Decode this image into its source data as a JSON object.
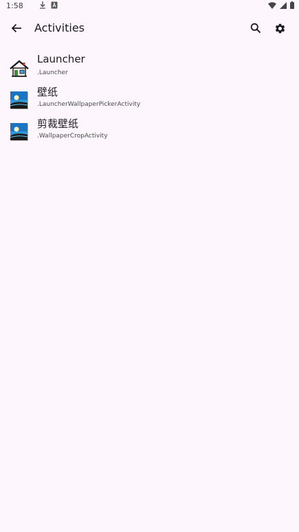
{
  "status_bar": {
    "time": "1:58",
    "icons": [
      "download-icon",
      "notification-a-icon",
      "wifi-icon",
      "cell-signal-icon",
      "battery-icon"
    ]
  },
  "app_bar": {
    "title": "Activities",
    "back_icon": "arrow-back-icon",
    "search_icon": "search-icon",
    "settings_icon": "gear-icon"
  },
  "activities": [
    {
      "name": "Launcher",
      "class_name": ".Launcher",
      "icon": "house-icon"
    },
    {
      "name": "壁纸",
      "class_name": ".LauncherWallpaperPickerActivity",
      "icon": "wallpaper-image-icon"
    },
    {
      "name": "剪裁壁纸",
      "class_name": ".WallpaperCropActivity",
      "icon": "wallpaper-image-icon"
    }
  ],
  "colors": {
    "background": "#fdf7fd",
    "text_primary": "#1c1b1f",
    "text_secondary": "#4a4a4a"
  }
}
